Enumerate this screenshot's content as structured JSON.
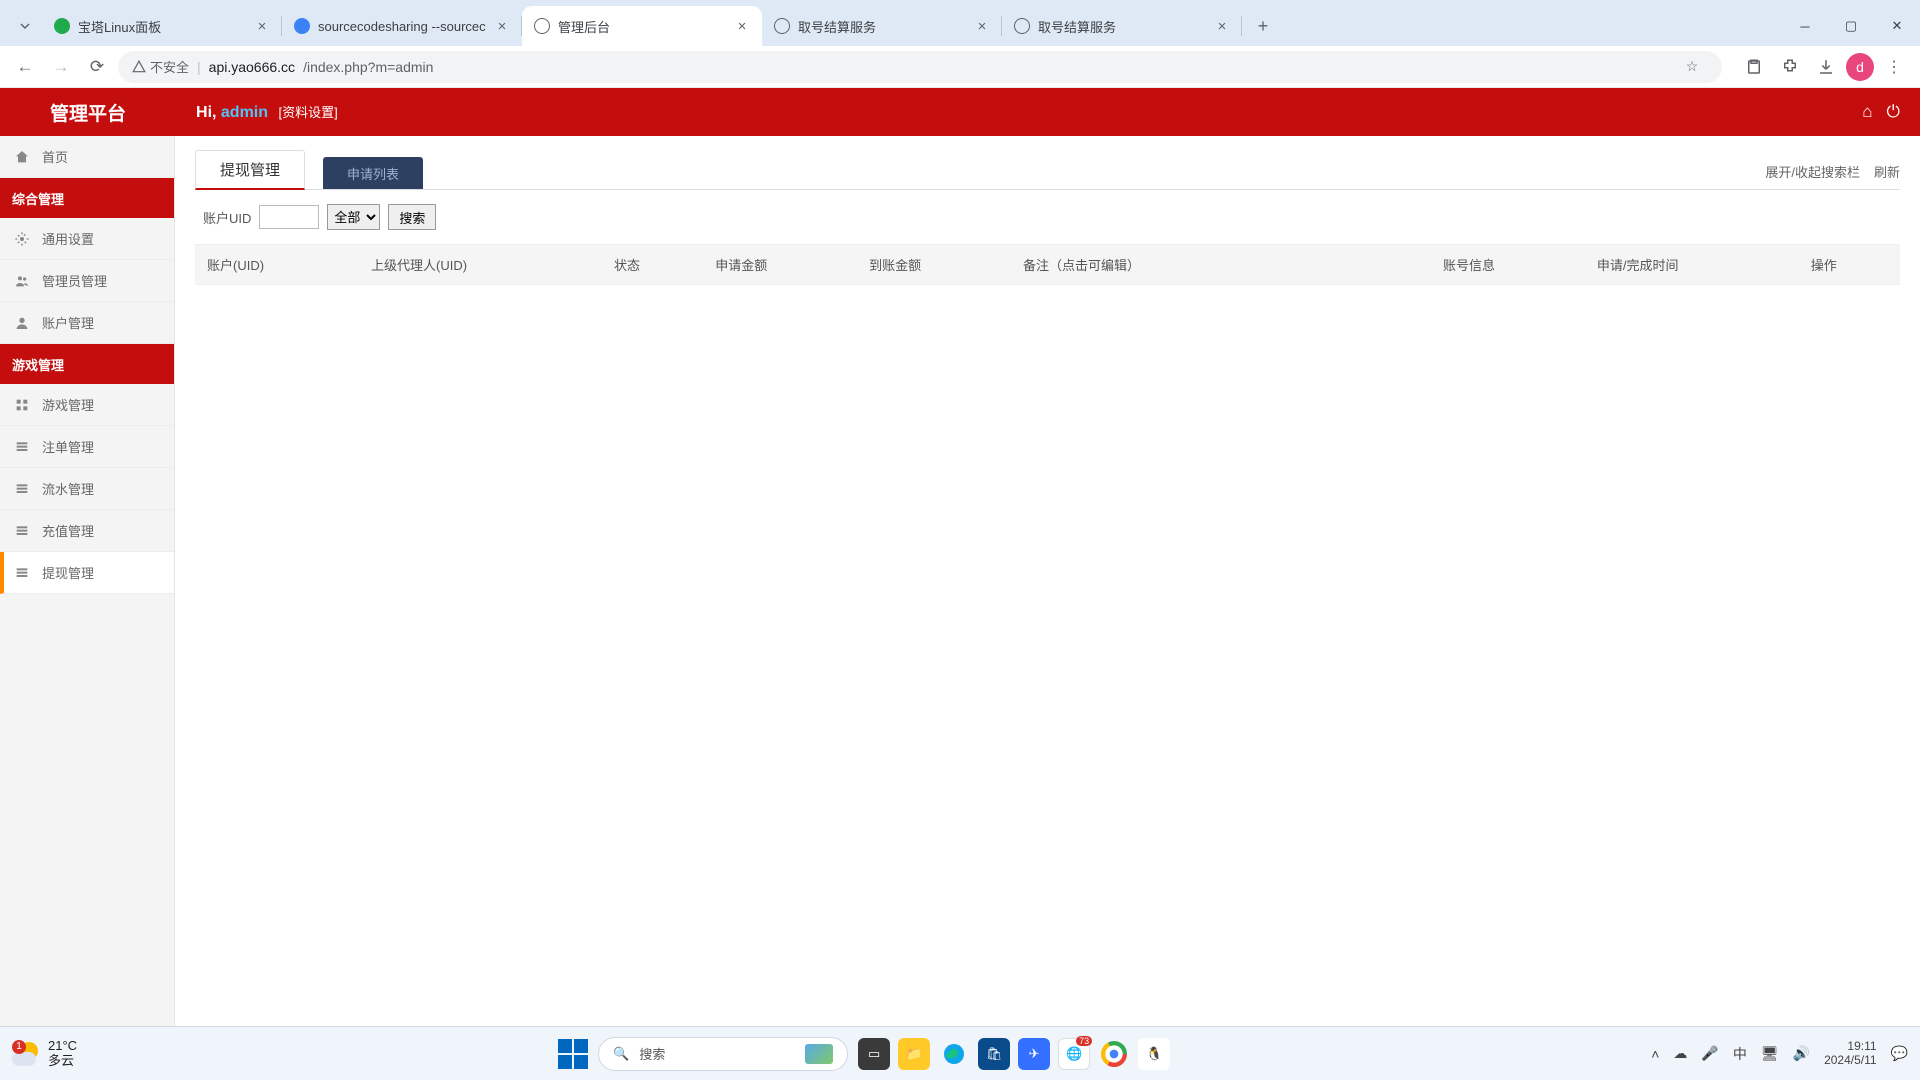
{
  "browser": {
    "tabs": [
      {
        "title": "宝塔Linux面板",
        "fav": "green"
      },
      {
        "title": "sourcecodesharing --sourcec",
        "fav": "blue"
      },
      {
        "title": "管理后台",
        "fav": "globe",
        "active": true
      },
      {
        "title": "取号结算服务",
        "fav": "globe"
      },
      {
        "title": "取号结算服务",
        "fav": "globe"
      }
    ],
    "url_warn": "不安全",
    "url_host": "api.yao666.cc",
    "url_path": "/index.php?m=admin",
    "avatar": "d"
  },
  "header": {
    "app_title": "管理平台",
    "greet_prefix": "Hi, ",
    "username": "admin",
    "profile_link": "[资料设置]"
  },
  "sidebar": {
    "home": "首页",
    "cat1": "综合管理",
    "items1": [
      "通用设置",
      "管理员管理",
      "账户管理"
    ],
    "cat2": "游戏管理",
    "items2": [
      "游戏管理",
      "注单管理",
      "流水管理",
      "充值管理",
      "提现管理"
    ]
  },
  "main": {
    "tab_current": "提现管理",
    "tab_other": "申请列表",
    "toggle_search": "展开/收起搜索栏",
    "refresh": "刷新",
    "search": {
      "uid_label": "账户UID",
      "status_label": "全部",
      "btn": "搜索"
    },
    "columns": [
      "账户(UID)",
      "上级代理人(UID)",
      "状态",
      "申请金额",
      "到账金额",
      "备注（点击可编辑）",
      "账号信息",
      "申请/完成时间",
      "操作"
    ]
  },
  "taskbar": {
    "weather_badge": "1",
    "temp": "21°C",
    "cond": "多云",
    "search_ph": "搜索",
    "qq_badge": "73",
    "ime": "中",
    "time": "19:11",
    "date": "2024/5/11"
  }
}
